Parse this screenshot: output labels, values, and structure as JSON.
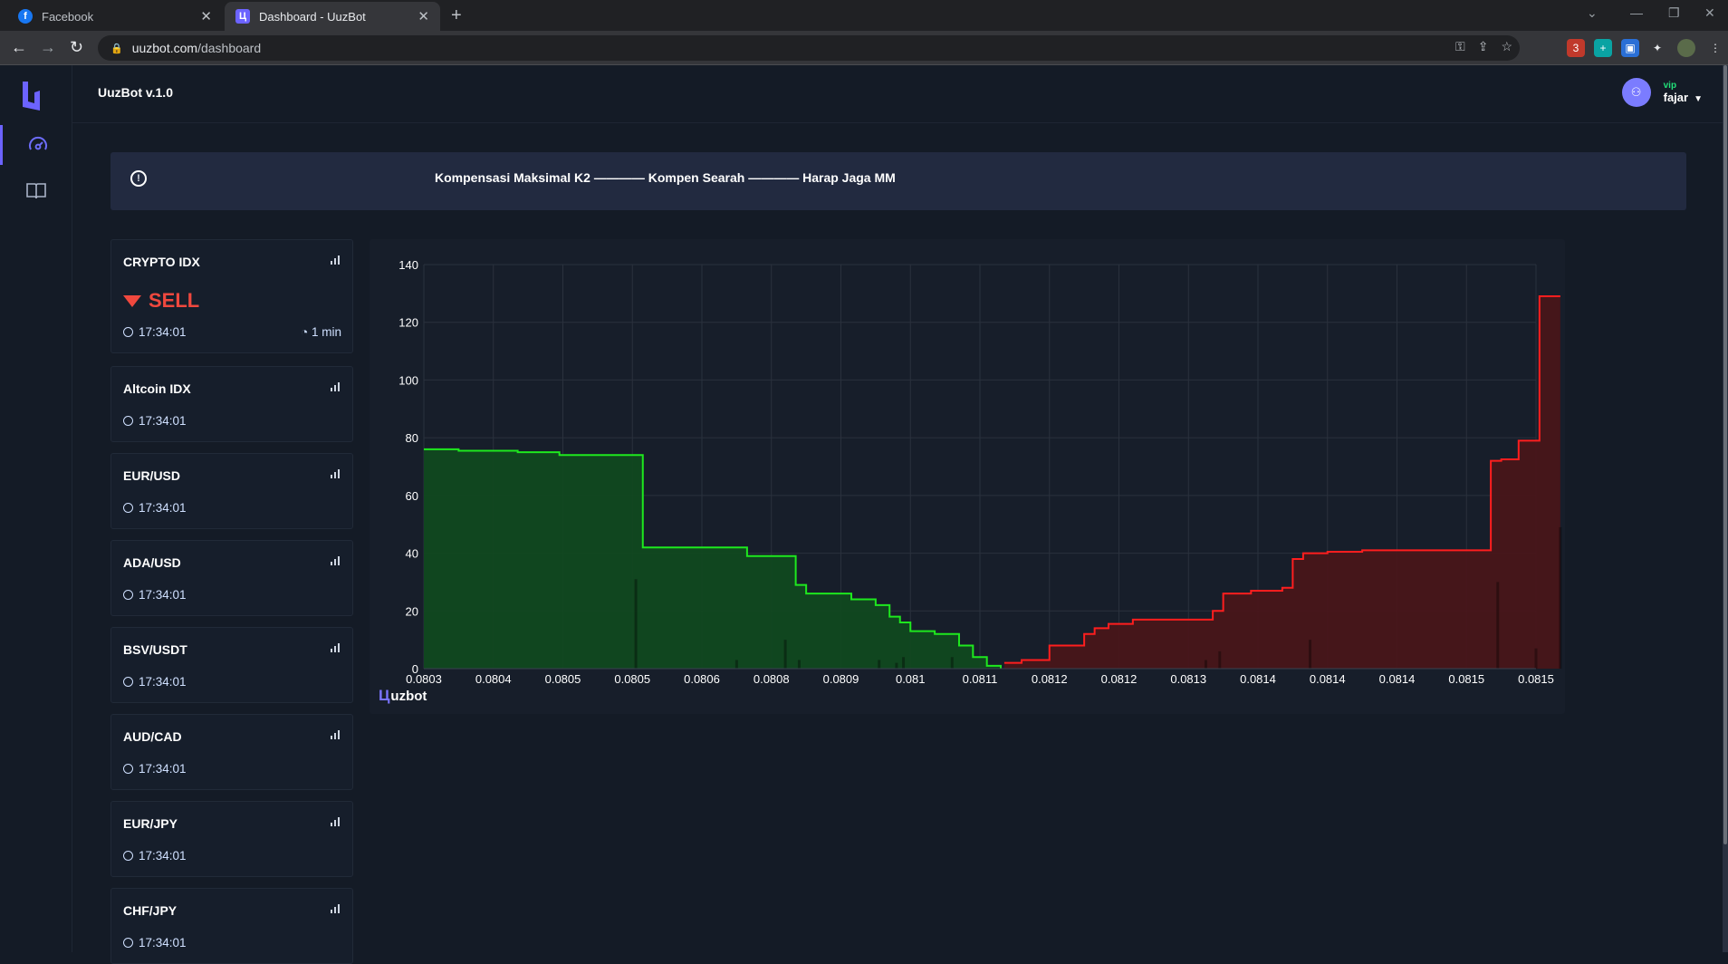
{
  "browser": {
    "tabs": [
      {
        "title": "Facebook",
        "favicon": "facebook-icon"
      },
      {
        "title": "Dashboard - UuzBot",
        "favicon": "uuzbot-icon"
      }
    ],
    "url": {
      "host": "uuzbot.com",
      "path": "/dashboard"
    },
    "extension_badge": "3"
  },
  "app": {
    "brand": "UuzBot v.1.0",
    "user": {
      "role": "vip",
      "name": "fajar"
    },
    "alert": "Kompensasi Maksimal K2 ———— Kompen Searah ———— Harap Jaga MM",
    "nav": [
      "dashboard-icon",
      "book-icon"
    ]
  },
  "cards": [
    {
      "name": "CRYPTO IDX",
      "signal": "SELL",
      "time": "17:34:01",
      "timeframe": "1 min"
    },
    {
      "name": "Altcoin IDX",
      "time": "17:34:01"
    },
    {
      "name": "EUR/USD",
      "time": "17:34:01"
    },
    {
      "name": "ADA/USD",
      "time": "17:34:01"
    },
    {
      "name": "BSV/USDT",
      "time": "17:34:01"
    },
    {
      "name": "AUD/CAD",
      "time": "17:34:01"
    },
    {
      "name": "EUR/JPY",
      "time": "17:34:01"
    },
    {
      "name": "CHF/JPY",
      "time": "17:34:01"
    }
  ],
  "chart_data": {
    "type": "area",
    "title": "",
    "xlabel": "",
    "ylabel": "",
    "watermark": "uzbot",
    "ylim": [
      0,
      140
    ],
    "yticks": [
      0,
      20,
      40,
      60,
      80,
      100,
      120,
      140
    ],
    "xticks": [
      "0.0803",
      "0.0804",
      "0.0805",
      "0.0805",
      "0.0806",
      "0.0808",
      "0.0809",
      "0.081",
      "0.0811",
      "0.0812",
      "0.0812",
      "0.0813",
      "0.0814",
      "0.0814",
      "0.0814",
      "0.0815",
      "0.0815"
    ],
    "grid": true,
    "series": [
      {
        "side": "bid",
        "color": "#1ee81e",
        "fill": "#0f4a1e",
        "steps": [
          [
            0.0,
            76
          ],
          [
            0.5,
            75.5
          ],
          [
            1.35,
            75
          ],
          [
            1.95,
            74
          ],
          [
            3.15,
            42
          ],
          [
            4.65,
            39
          ],
          [
            5.35,
            29
          ],
          [
            5.5,
            26
          ],
          [
            6.15,
            24
          ],
          [
            6.5,
            22
          ],
          [
            6.7,
            18
          ],
          [
            6.85,
            16
          ],
          [
            7.0,
            13
          ],
          [
            7.35,
            12
          ],
          [
            7.7,
            8
          ],
          [
            7.9,
            4
          ],
          [
            8.1,
            1
          ],
          [
            8.3,
            0
          ]
        ]
      },
      {
        "side": "ask",
        "color": "#ff1e1e",
        "fill": "#4a1518",
        "steps": [
          [
            8.35,
            2
          ],
          [
            8.6,
            3
          ],
          [
            9.0,
            8
          ],
          [
            9.5,
            12
          ],
          [
            9.65,
            14
          ],
          [
            9.85,
            15.5
          ],
          [
            10.2,
            17
          ],
          [
            11.35,
            20
          ],
          [
            11.5,
            26
          ],
          [
            11.9,
            27
          ],
          [
            12.35,
            28
          ],
          [
            12.5,
            38
          ],
          [
            12.65,
            40
          ],
          [
            13.0,
            40.5
          ],
          [
            13.5,
            41
          ],
          [
            15.35,
            72
          ],
          [
            15.5,
            72.5
          ],
          [
            15.75,
            79
          ],
          [
            16.05,
            129
          ],
          [
            16.35,
            129
          ]
        ]
      }
    ],
    "volume_bars": [
      {
        "x": 3.05,
        "v": 31
      },
      {
        "x": 4.5,
        "v": 3
      },
      {
        "x": 5.2,
        "v": 10
      },
      {
        "x": 5.4,
        "v": 3
      },
      {
        "x": 6.55,
        "v": 3
      },
      {
        "x": 6.8,
        "v": 2
      },
      {
        "x": 6.9,
        "v": 4
      },
      {
        "x": 7.6,
        "v": 4
      },
      {
        "x": 11.25,
        "v": 3
      },
      {
        "x": 11.45,
        "v": 6
      },
      {
        "x": 12.75,
        "v": 10
      },
      {
        "x": 15.45,
        "v": 30
      },
      {
        "x": 16.0,
        "v": 7
      },
      {
        "x": 16.35,
        "v": 49
      }
    ]
  }
}
